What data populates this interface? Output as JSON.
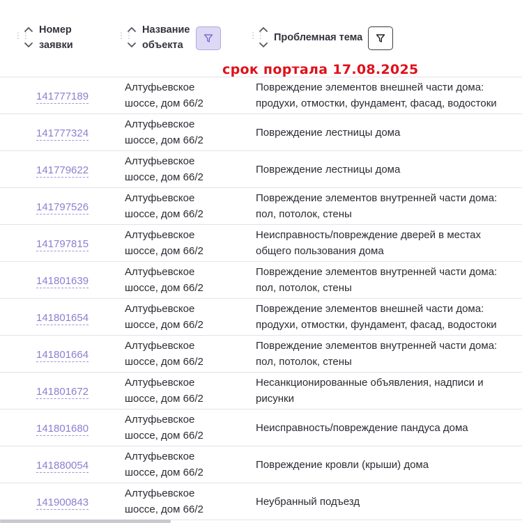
{
  "header": {
    "col_number": "Номер\nзаявки",
    "col_object": "Название\nобъекта",
    "col_topic": "Проблемная тема",
    "deadline_note": "срок портала 17.08.2025"
  },
  "colors": {
    "link": "#8b7fd0",
    "filter_active_bg": "#ddd9f5",
    "deadline": "#e0101a"
  },
  "rows": [
    {
      "id": "141777189",
      "address": [
        "Алтуфьевское",
        "шоссе, дом 66/2"
      ],
      "topic": "Повреждение элементов внешней части дома:\nпродухи, отмостки, фундамент, фасад, водостоки"
    },
    {
      "id": "141777324",
      "address": [
        "Алтуфьевское",
        "шоссе, дом 66/2"
      ],
      "topic": "Повреждение лестницы дома"
    },
    {
      "id": "141779622",
      "address": [
        "Алтуфьевское",
        "шоссе, дом 66/2"
      ],
      "topic": "Повреждение лестницы дома"
    },
    {
      "id": "141797526",
      "address": [
        "Алтуфьевское",
        "шоссе, дом 66/2"
      ],
      "topic": "Повреждение элементов внутренней части дома:\nпол, потолок, стены"
    },
    {
      "id": "141797815",
      "address": [
        "Алтуфьевское",
        "шоссе, дом 66/2"
      ],
      "topic": "Неисправность/повреждение дверей в местах\nобщего пользования дома"
    },
    {
      "id": "141801639",
      "address": [
        "Алтуфьевское",
        "шоссе, дом 66/2"
      ],
      "topic": "Повреждение элементов внутренней части дома:\nпол, потолок, стены"
    },
    {
      "id": "141801654",
      "address": [
        "Алтуфьевское",
        "шоссе, дом 66/2"
      ],
      "topic": "Повреждение элементов внешней части дома:\nпродухи, отмостки, фундамент, фасад, водостоки"
    },
    {
      "id": "141801664",
      "address": [
        "Алтуфьевское",
        "шоссе, дом 66/2"
      ],
      "topic": "Повреждение элементов внутренней части дома:\nпол, потолок, стены"
    },
    {
      "id": "141801672",
      "address": [
        "Алтуфьевское",
        "шоссе, дом 66/2"
      ],
      "topic": "Несанкционированные объявления, надписи и\nрисунки"
    },
    {
      "id": "141801680",
      "address": [
        "Алтуфьевское",
        "шоссе, дом 66/2"
      ],
      "topic": "Неисправность/повреждение пандуса дома"
    },
    {
      "id": "141880054",
      "address": [
        "Алтуфьевское",
        "шоссе, дом 66/2"
      ],
      "topic": "Повреждение кровли (крыши) дома"
    },
    {
      "id": "141900843",
      "address": [
        "Алтуфьевское",
        "шоссе, дом 66/2"
      ],
      "topic": "Неубранный подъезд"
    }
  ]
}
